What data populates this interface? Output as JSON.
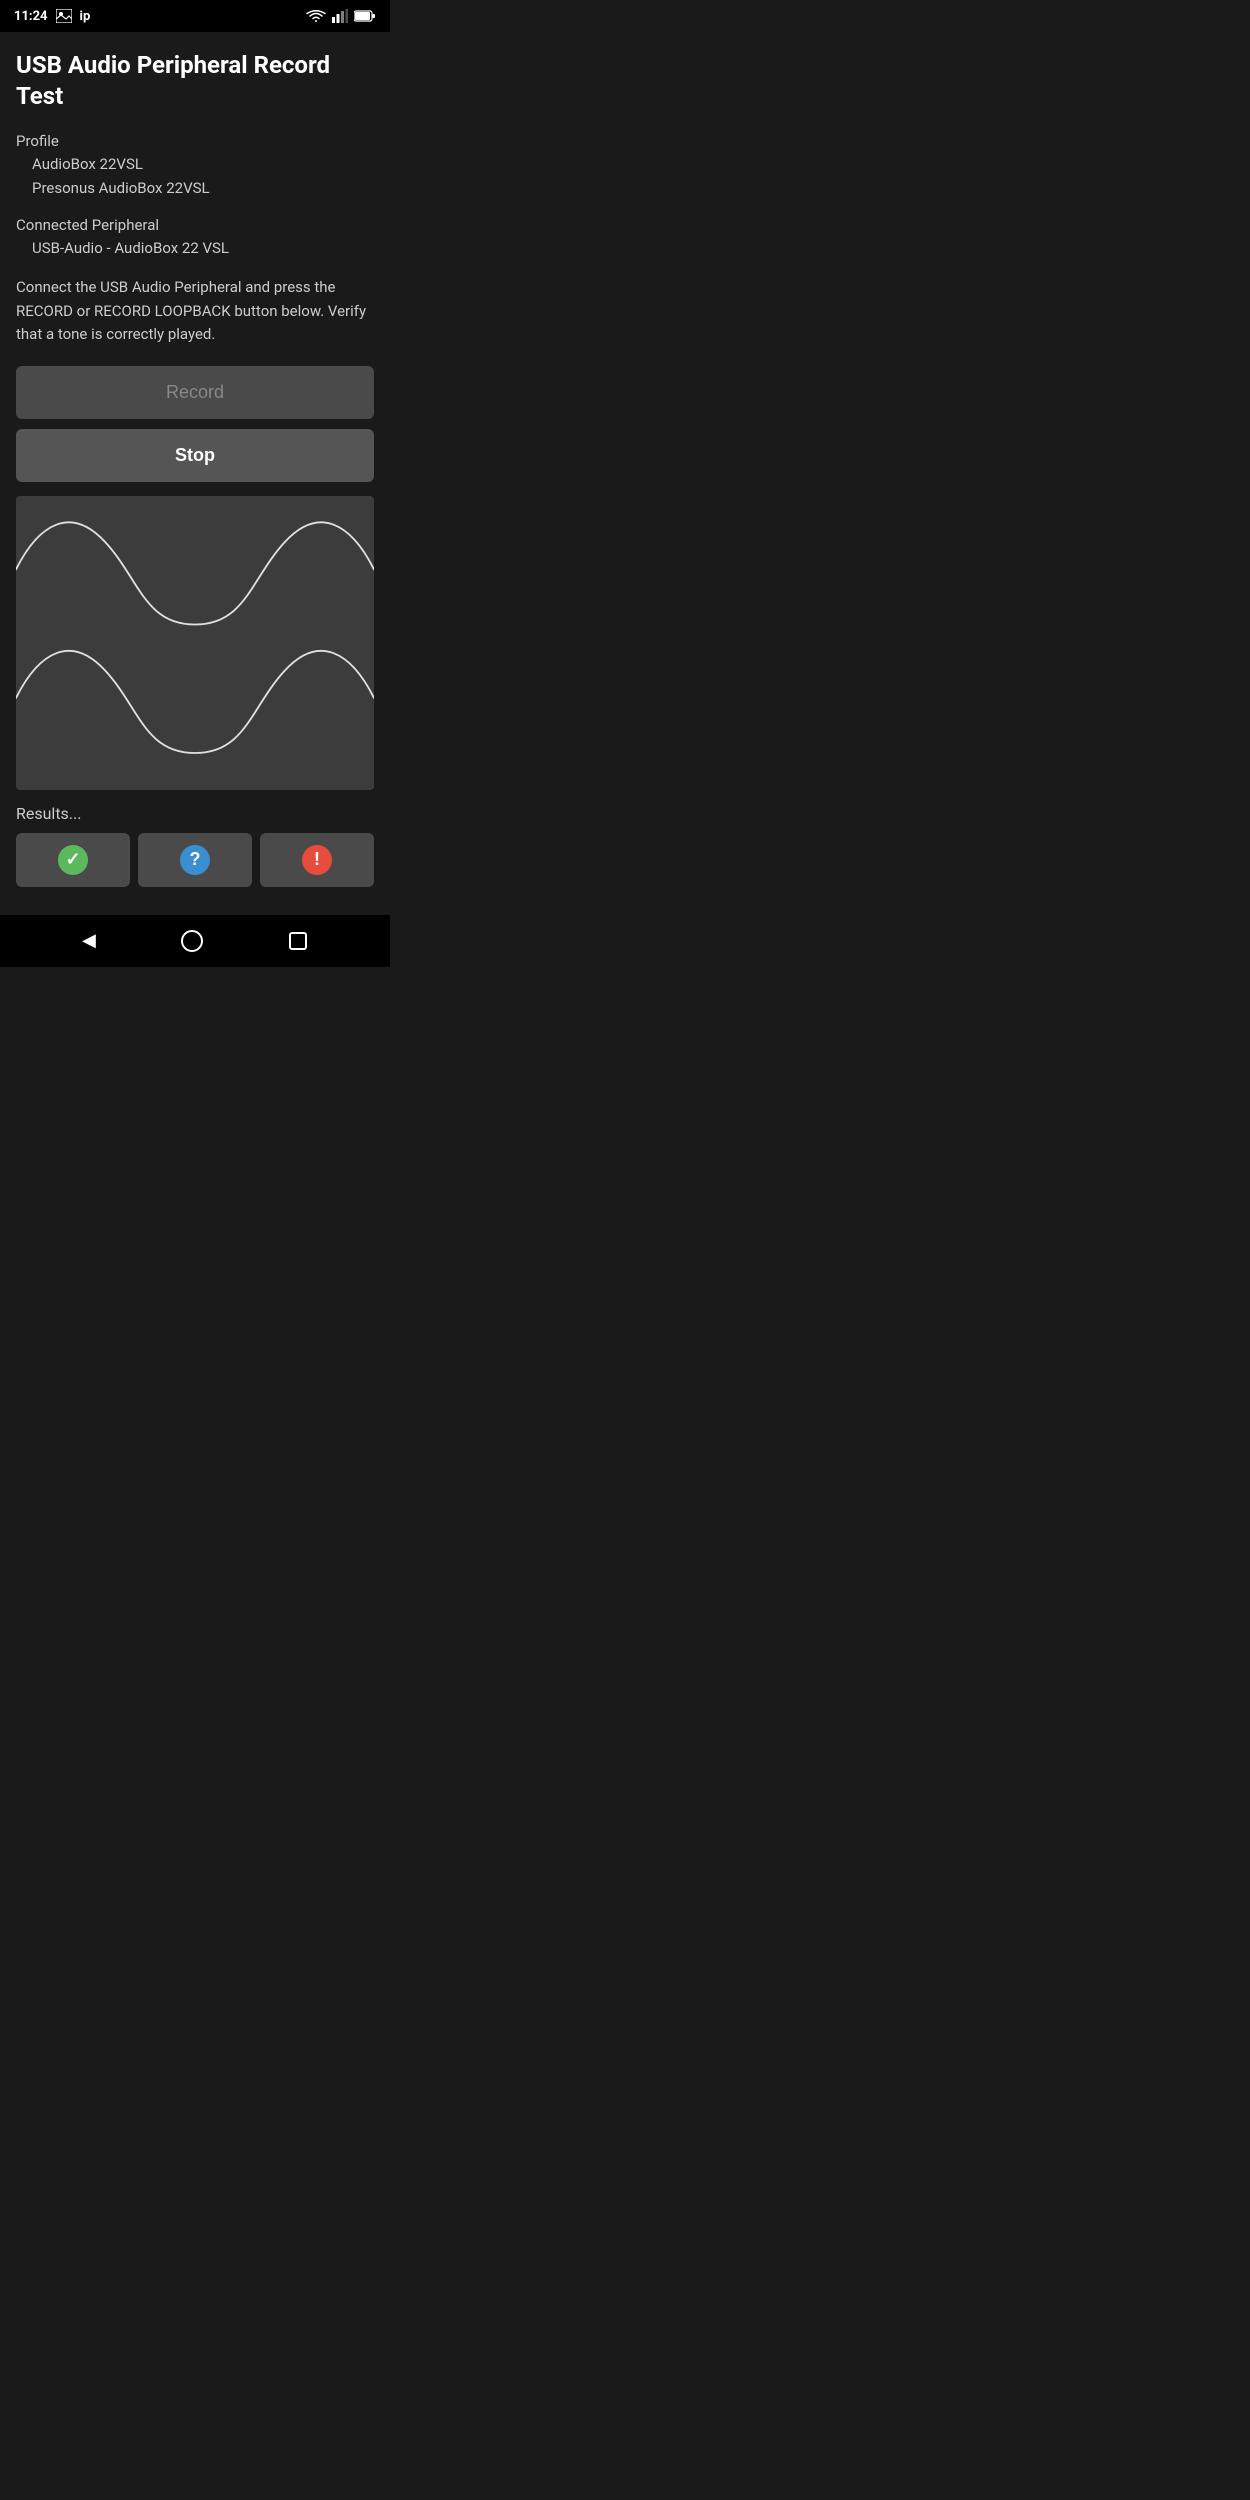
{
  "statusBar": {
    "time": "11:24",
    "icons": [
      "image",
      "ip"
    ]
  },
  "header": {
    "title": "USB Audio Peripheral Record Test"
  },
  "profile": {
    "label": "Profile",
    "line1": "AudioBox 22VSL",
    "line2": "Presonus AudioBox 22VSL"
  },
  "connectedPeripheral": {
    "label": "Connected Peripheral",
    "value": "USB-Audio - AudioBox 22 VSL"
  },
  "instruction": "Connect the USB Audio Peripheral and press the RECORD or RECORD LOOPBACK button below. Verify that a tone is correctly played.",
  "buttons": {
    "record": "Record",
    "stop": "Stop"
  },
  "results": {
    "label": "Results...",
    "checkIcon": "✓",
    "questionIcon": "?",
    "exclamationIcon": "!"
  },
  "navBar": {
    "back": "◀",
    "home": "○",
    "recents": "□"
  }
}
